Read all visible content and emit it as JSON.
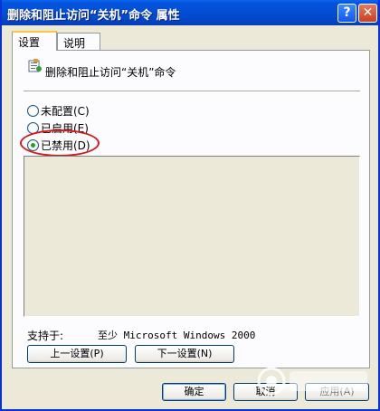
{
  "window": {
    "title": "删除和阻止访问“关机”命令 属性",
    "help_button": "?",
    "close_button": "✕"
  },
  "tabs": [
    {
      "label": "设置",
      "active": true
    },
    {
      "label": "说明",
      "active": false
    }
  ],
  "policy": {
    "name": "删除和阻止访问“关机”命令",
    "icon": "policy-setting-icon"
  },
  "options": {
    "not_configured": "未配置(C)",
    "enabled": "已启用(E)",
    "disabled": "已禁用(D)",
    "selected": "disabled"
  },
  "supported": {
    "label": "支持于:",
    "value": "至少 Microsoft Windows 2000"
  },
  "nav": {
    "prev_label": "上一设置(P)",
    "next_label": "下一设置(N)"
  },
  "footer": {
    "ok_label": "确定",
    "cancel_label": "取消",
    "apply_label": "应用(A)"
  },
  "colors": {
    "titlebar": "#0453dc",
    "highlight": "#d41a1a",
    "selected_radio": "#21a121"
  }
}
